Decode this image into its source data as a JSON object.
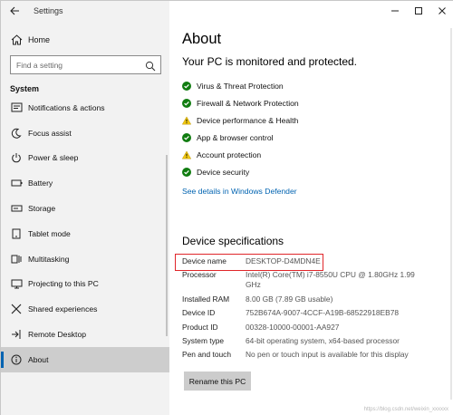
{
  "window": {
    "app_title": "Settings",
    "back_icon": "back-arrow-icon",
    "controls": [
      "minimize-icon",
      "maximize-icon",
      "close-icon"
    ]
  },
  "sidebar": {
    "home_label": "Home",
    "search_placeholder": "Find a setting",
    "section_title": "System",
    "items": [
      {
        "label": "Notifications & actions",
        "icon": "notifications-icon"
      },
      {
        "label": "Focus assist",
        "icon": "moon-icon"
      },
      {
        "label": "Power & sleep",
        "icon": "power-icon"
      },
      {
        "label": "Battery",
        "icon": "battery-icon"
      },
      {
        "label": "Storage",
        "icon": "storage-icon"
      },
      {
        "label": "Tablet mode",
        "icon": "tablet-icon"
      },
      {
        "label": "Multitasking",
        "icon": "multitasking-icon"
      },
      {
        "label": "Projecting to this PC",
        "icon": "projecting-icon"
      },
      {
        "label": "Shared experiences",
        "icon": "shared-icon"
      },
      {
        "label": "Remote Desktop",
        "icon": "remote-icon"
      },
      {
        "label": "About",
        "icon": "info-icon",
        "active": true
      }
    ]
  },
  "main": {
    "title": "About",
    "status_heading": "Your PC is monitored and protected.",
    "security_items": [
      {
        "label": "Virus & Threat Protection",
        "status": "ok"
      },
      {
        "label": "Firewall & Network Protection",
        "status": "ok"
      },
      {
        "label": "Device performance & Health",
        "status": "warning"
      },
      {
        "label": "App & browser control",
        "status": "ok"
      },
      {
        "label": "Account protection",
        "status": "warning"
      },
      {
        "label": "Device security",
        "status": "ok"
      }
    ],
    "defender_link": "See details in Windows Defender",
    "specs_heading": "Device specifications",
    "specs": [
      {
        "key": "Device name",
        "value": "DESKTOP-D4MDN4E"
      },
      {
        "key": "Processor",
        "value": "Intel(R) Core(TM) i7-8550U CPU @ 1.80GHz   1.99 GHz"
      },
      {
        "key": "Installed RAM",
        "value": "8.00 GB (7.89 GB usable)"
      },
      {
        "key": "Device ID",
        "value": "752B674A-9007-4CCF-A19B-68522918EB78"
      },
      {
        "key": "Product ID",
        "value": "00328-10000-00001-AA927"
      },
      {
        "key": "System type",
        "value": "64-bit operating system, x64-based processor"
      },
      {
        "key": "Pen and touch",
        "value": "No pen or touch input is available for this display"
      }
    ],
    "rename_button": "Rename this PC",
    "watermark": "https://blog.csdn.net/weixin_xxxxxx"
  },
  "colors": {
    "accent": "#0063b1",
    "ok": "#107c10",
    "warning": "#f2c811",
    "highlight_box": "#e0262a"
  }
}
